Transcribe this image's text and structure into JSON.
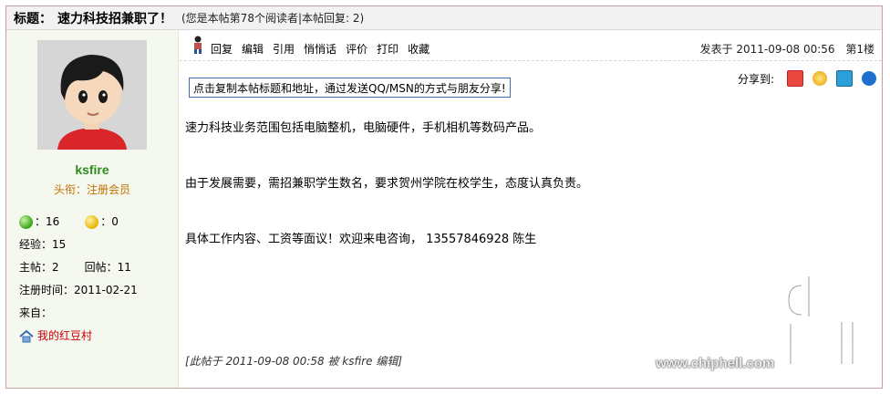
{
  "thread": {
    "label": "标题：",
    "title": "速力科技招兼职了！",
    "info": "(您是本帖第78个阅读者|本帖回复: 2)"
  },
  "user": {
    "name": "ksfire",
    "rank": "头衔：注册会员",
    "green_count": "：16",
    "yellow_count": "：0",
    "exp": "经验：15",
    "posts_label": "主帖：2",
    "replies_label": "回帖：11",
    "register": "注册时间：2011-02-21",
    "from": "来自：",
    "home_link": "我的红豆村"
  },
  "toolbar": {
    "items": [
      "回复",
      "编辑",
      "引用",
      "悄悄话",
      "评价",
      "打印",
      "收藏"
    ]
  },
  "post": {
    "posted_at": "发表于 2011-09-08 00:56",
    "floor": "第1楼",
    "copy_button": "点击复制本帖标题和地址，通过发送QQ/MSN的方式与朋友分享!",
    "share_label": "分享到:",
    "paragraphs": [
      "速力科技业务范围包括电脑整机，电脑硬件，手机相机等数码产品。",
      "由于发展需要，需招兼职学生数名，要求贺州学院在校学生，态度认真负责。",
      "具体工作内容、工资等面议！欢迎来电咨询， 13557846928 陈生"
    ],
    "edited_note": "[此帖于 2011-09-08 00:58 被 ksfire 编辑]"
  },
  "watermark": {
    "text": "chip hell",
    "url": "www.chiphell.com"
  },
  "icons": [
    "person-icon",
    "home-icon",
    "green-ball-icon",
    "yellow-ball-icon",
    "share-icon-1",
    "share-icon-2",
    "share-icon-3",
    "share-icon-4"
  ]
}
